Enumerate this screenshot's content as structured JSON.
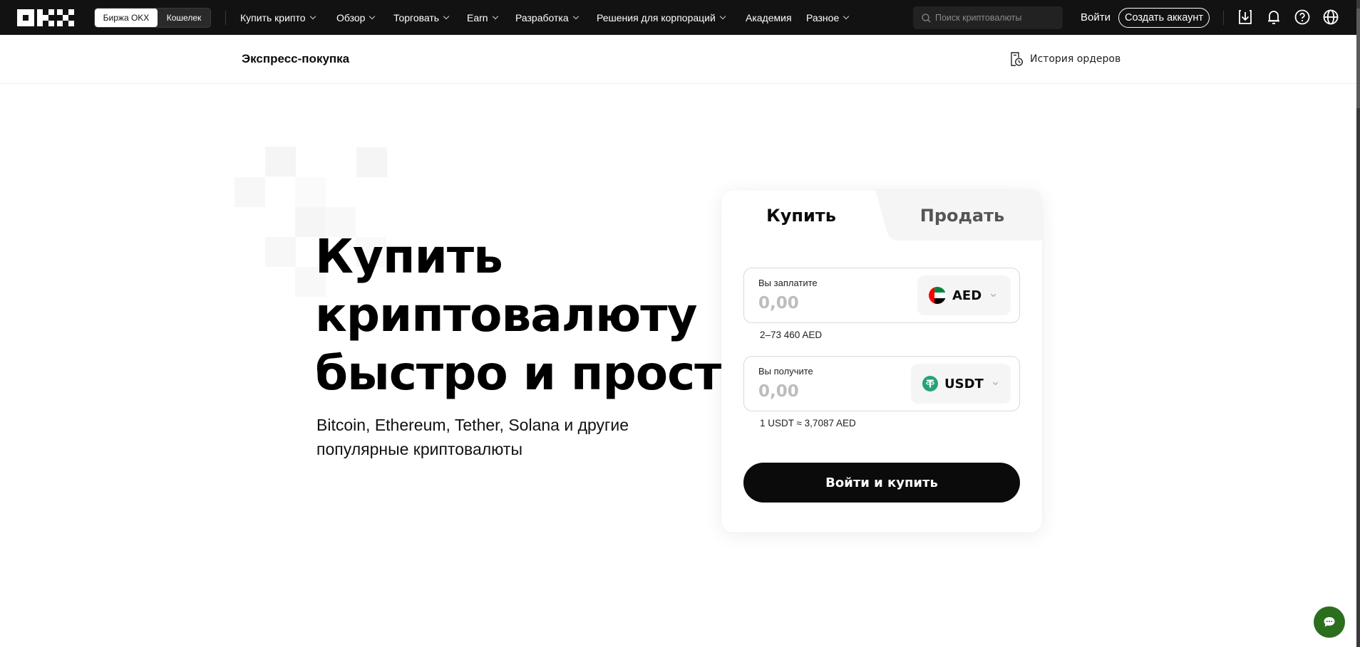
{
  "nav": {
    "logo": "OKX",
    "toggle": {
      "exchange": "Биржа OKX",
      "wallet": "Кошелек"
    },
    "menu": [
      {
        "label": "Купить крипто",
        "has_dropdown": true
      },
      {
        "label": "Обзор",
        "has_dropdown": true
      },
      {
        "label": "Торговать",
        "has_dropdown": true
      },
      {
        "label": "Earn",
        "has_dropdown": true
      },
      {
        "label": "Разработка",
        "has_dropdown": true
      },
      {
        "label": "Решения для корпораций",
        "has_dropdown": true
      },
      {
        "label": "Академия",
        "has_dropdown": false
      },
      {
        "label": "Разное",
        "has_dropdown": true
      }
    ],
    "search_placeholder": "Поиск криптовалюты",
    "login": "Войти",
    "create_account": "Создать аккаунт",
    "icons": [
      "download-icon",
      "bell-icon",
      "help-icon",
      "globe-icon"
    ]
  },
  "subheader": {
    "title": "Экспресс-покупка",
    "order_history": "История ордеров"
  },
  "hero": {
    "title_lines": [
      "Купить",
      "криптовалюту",
      "быстро и просто"
    ],
    "subtitle_lines": [
      "Bitcoin, Ethereum, Tether, Solana и другие",
      "популярные криптовалюты"
    ]
  },
  "card": {
    "tabs": [
      {
        "label": "Купить",
        "active": true
      },
      {
        "label": "Продать",
        "active": false
      }
    ],
    "pay": {
      "label": "Вы заплатите",
      "value": "",
      "placeholder": "0,00",
      "currency": "AED",
      "hint": "2–73 460 AED"
    },
    "receive": {
      "label": "Вы получите",
      "value": "",
      "placeholder": "0,00",
      "currency": "USDT",
      "hint": "1 USDT ≈ 3,7087 AED"
    },
    "submit": "Войти и купить"
  },
  "colors": {
    "nav_bg": "#121212",
    "primary_button": "#0b0b0b",
    "tether_green": "#26a17b",
    "chat_button": "#2a6e1e",
    "inactive_tab_bg": "#f5f5f5"
  }
}
